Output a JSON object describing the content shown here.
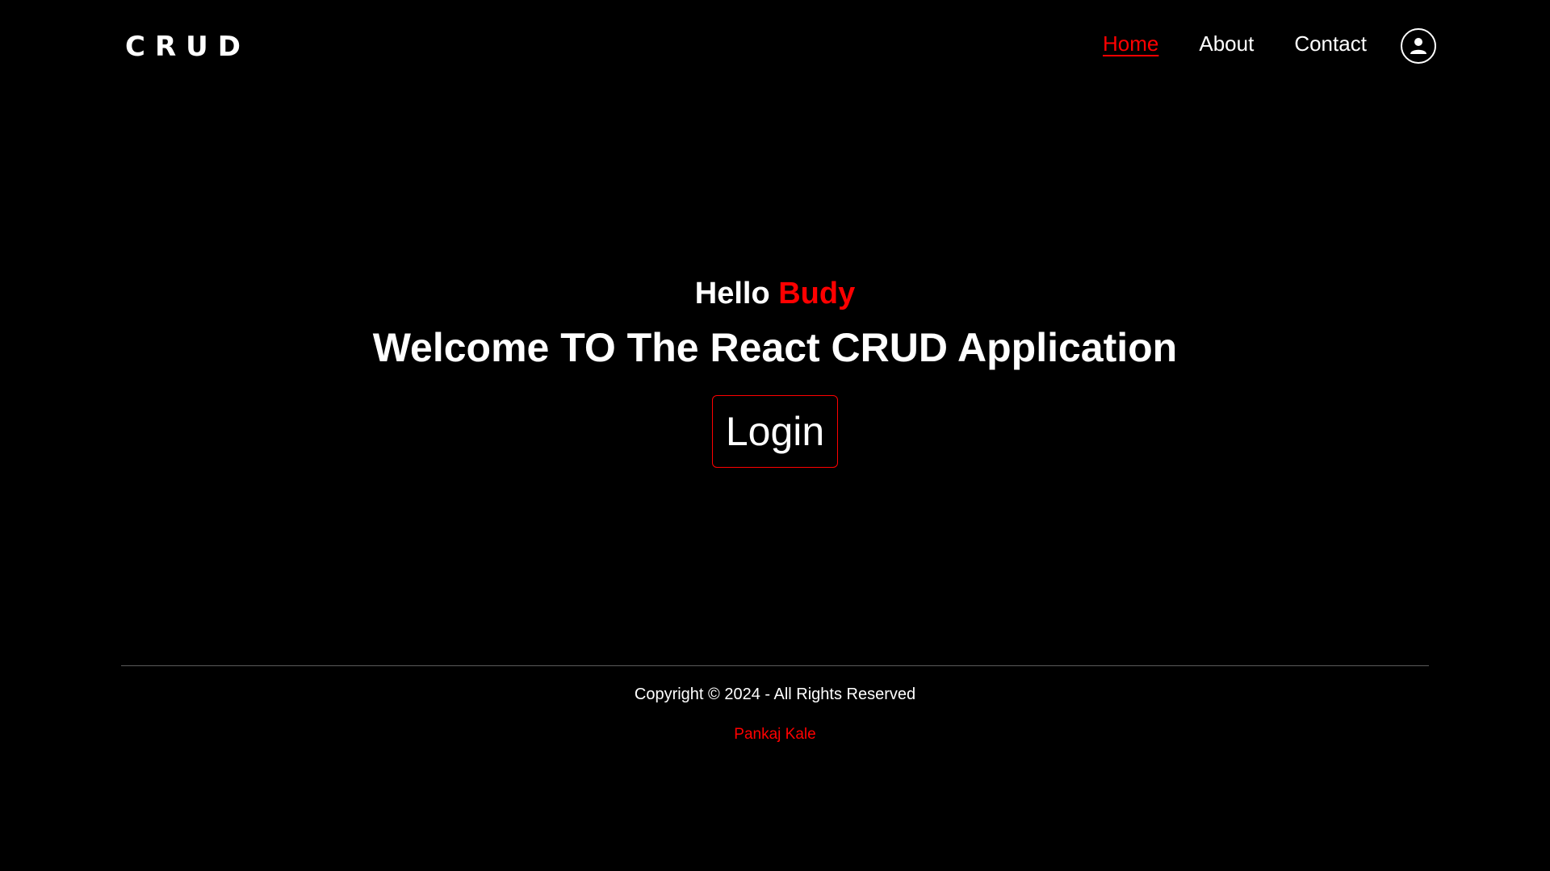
{
  "header": {
    "logo": "CRUD",
    "nav": [
      {
        "label": "Home",
        "active": true
      },
      {
        "label": "About",
        "active": false
      },
      {
        "label": "Contact",
        "active": false
      }
    ],
    "profile_icon": "user-circle-icon"
  },
  "hero": {
    "greeting": "Hello",
    "name": "Budy",
    "welcome": "Welcome TO The React CRUD Application",
    "login_label": "Login"
  },
  "footer": {
    "copyright": "Copyright © 2024 - All Rights Reserved",
    "author": "Pankaj Kale"
  },
  "colors": {
    "background": "#000000",
    "accent": "#ff0000",
    "text": "#ffffff"
  }
}
